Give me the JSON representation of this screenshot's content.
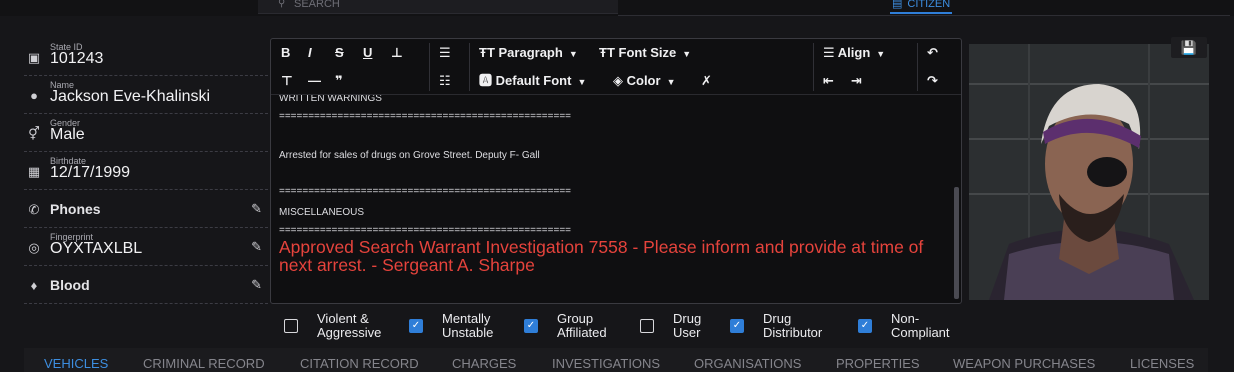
{
  "topbar": {
    "search_placeholder": "SEARCH",
    "citizen_tab": "CITIZEN"
  },
  "profile": {
    "state_id": {
      "label": "State ID",
      "value": "101243"
    },
    "name": {
      "label": "Name",
      "value": "Jackson Eve-Khalinski"
    },
    "gender": {
      "label": "Gender",
      "value": "Male"
    },
    "birthdate": {
      "label": "Birthdate",
      "value": "12/17/1999"
    },
    "phones": {
      "label": "Phones"
    },
    "fingerprint": {
      "label": "Fingerprint",
      "value": "OYXTAXLBL"
    },
    "blood": {
      "label": "Blood"
    }
  },
  "toolbar": {
    "paragraph": "Paragraph",
    "font_size": "Font Size",
    "align": "Align",
    "default_font": "Default Font",
    "color": "Color"
  },
  "notes": {
    "line1": "WRITTEN WARNINGS",
    "line2": "==================================================",
    "line3": "Arrested for sales of drugs on Grove Street. Deputy F- Gall",
    "line4": "==================================================",
    "line5": "MISCELLANEOUS",
    "line6": "==================================================",
    "warning": "Approved Search Warrant Investigation 7558 - Please inform and provide at time of next arrest. - Sergeant A. Sharpe",
    "warning_color": "#e5433c"
  },
  "flags": [
    {
      "label": "Violent &\nAggressive",
      "checked": false
    },
    {
      "label": "Mentally\nUnstable",
      "checked": true
    },
    {
      "label": "Group\nAffiliated",
      "checked": true
    },
    {
      "label": "Drug\nUser",
      "checked": false
    },
    {
      "label": "Drug\nDistributor",
      "checked": true
    },
    {
      "label": "Non-\nCompliant",
      "checked": true
    }
  ],
  "nav": [
    "VEHICLES",
    "CRIMINAL RECORD",
    "CITATION RECORD",
    "CHARGES",
    "INVESTIGATIONS",
    "ORGANISATIONS",
    "PROPERTIES",
    "WEAPON PURCHASES",
    "LICENSES"
  ],
  "accent_color": "#2f7ed8",
  "icons": {
    "save": "save-icon",
    "undo": "undo-icon",
    "redo": "redo-icon"
  }
}
